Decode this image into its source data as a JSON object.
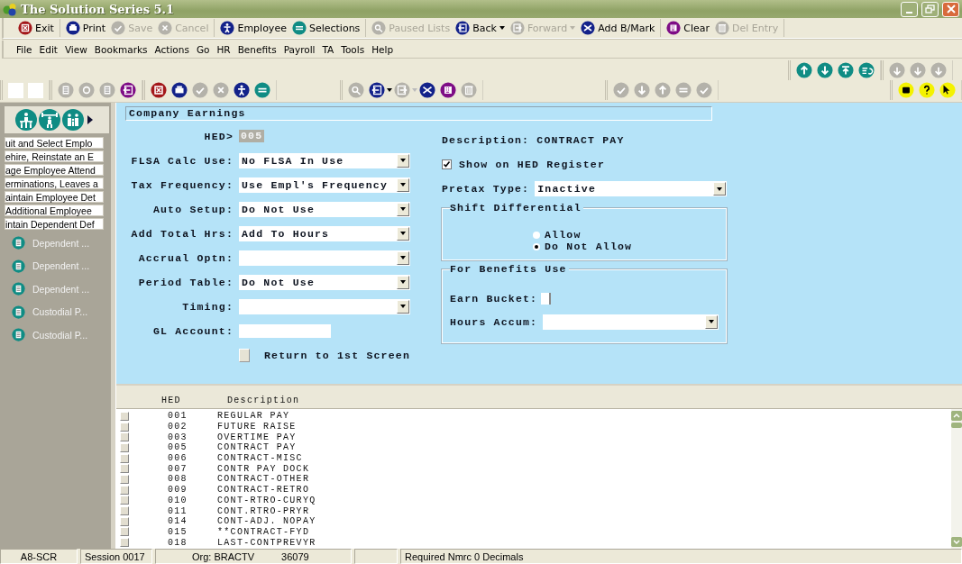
{
  "window": {
    "title": "The Solution Series  5.1"
  },
  "toolbar": [
    {
      "label": "Exit",
      "disabled": false
    },
    {
      "label": "Print",
      "disabled": false
    },
    {
      "label": "Save",
      "disabled": true
    },
    {
      "label": "Cancel",
      "disabled": true
    },
    {
      "label": "Employee",
      "disabled": false
    },
    {
      "label": "Selections",
      "disabled": false
    },
    {
      "label": "Paused Lists",
      "disabled": true
    },
    {
      "label": "Back",
      "disabled": false,
      "dropdown": true
    },
    {
      "label": "Forward",
      "disabled": true,
      "dropdown": true
    },
    {
      "label": "Add B/Mark",
      "disabled": false
    },
    {
      "label": "Clear",
      "disabled": false
    },
    {
      "label": "Del Entry",
      "disabled": true
    }
  ],
  "menu": [
    "File",
    "Edit",
    "View",
    "Bookmarks",
    "Actions",
    "Go",
    "HR",
    "Benefits",
    "Payroll",
    "TA",
    "Tools",
    "Help"
  ],
  "nav_toolbar": [
    {
      "disabled": false
    },
    {
      "disabled": false
    },
    {
      "disabled": false
    },
    {
      "disabled": false
    },
    {
      "disabled": true
    },
    {
      "disabled": true
    },
    {
      "disabled": true
    }
  ],
  "icon_toolbar": [
    {
      "disabled": true
    },
    {
      "disabled": true
    },
    {
      "disabled": true
    },
    {
      "disabled": false
    },
    {
      "disabled": false
    },
    {
      "disabled": false
    },
    {
      "disabled": true
    },
    {
      "disabled": true
    },
    {
      "disabled": false
    },
    {
      "disabled": false
    },
    {
      "disabled": true
    },
    {
      "disabled": false
    },
    {
      "disabled": true
    },
    {
      "disabled": false
    },
    {
      "disabled": false
    },
    {
      "disabled": true
    },
    {
      "disabled": true
    },
    {
      "disabled": true
    },
    {
      "disabled": true
    },
    {
      "disabled": true
    },
    {
      "disabled": true
    },
    {
      "disabled": false
    },
    {
      "disabled": false
    },
    {
      "disabled": false
    }
  ],
  "sidebar": {
    "links": [
      "uit and Select Emplo",
      "ehire, Reinstate an E",
      "age Employee Attend",
      "erminations, Leaves a",
      "aintain Employee Det",
      "Additional Employee",
      "intain Dependent Def"
    ],
    "items": [
      "Dependent ...",
      "Dependent ...",
      "Dependent ...",
      "Custodial P...",
      "Custodial P..."
    ]
  },
  "form": {
    "title": "Company Earnings",
    "hed": {
      "label": "HED>",
      "value": "005"
    },
    "fields": [
      {
        "label": "FLSA Calc Use:",
        "value": "No FLSA In Use",
        "kind": "dropdown"
      },
      {
        "label": "Tax Frequency:",
        "value": "Use Empl's Frequency",
        "kind": "dropdown"
      },
      {
        "label": "Auto Setup:",
        "value": "Do Not Use",
        "kind": "dropdown"
      },
      {
        "label": "Add Total Hrs:",
        "value": "Add To Hours",
        "kind": "dropdown"
      },
      {
        "label": "Accrual Optn:",
        "kind": "dropdown"
      },
      {
        "label": "Period Table:",
        "value": "Do Not Use",
        "kind": "dropdown"
      },
      {
        "label": "Timing:",
        "kind": "dropdown"
      },
      {
        "label": "GL Account:",
        "kind": "text"
      }
    ],
    "return_button": "Return to 1st Screen",
    "description": "Description: CONTRACT PAY",
    "show_on_register": {
      "label": "Show on HED Register",
      "checked": true
    },
    "pretax": {
      "label": "Pretax Type:",
      "value": "Inactive"
    },
    "shift_differential": {
      "title": "Shift Differential",
      "options": [
        {
          "label": "Allow",
          "selected": false
        },
        {
          "label": "Do Not Allow",
          "selected": true
        }
      ]
    },
    "benefits": {
      "title": "For Benefits Use",
      "earn_bucket": "Earn Bucket:",
      "hours_accum": "Hours Accum:"
    }
  },
  "list": {
    "columns": [
      "HED",
      "Description"
    ],
    "rows": [
      [
        "001",
        "REGULAR PAY"
      ],
      [
        "002",
        "FUTURE RAISE"
      ],
      [
        "003",
        "OVERTIME PAY"
      ],
      [
        "005",
        "CONTRACT PAY"
      ],
      [
        "006",
        "CONTRACT-MISC"
      ],
      [
        "007",
        "CONTR PAY DOCK"
      ],
      [
        "008",
        "CONTRACT-OTHER"
      ],
      [
        "009",
        "CONTRACT-RETRO"
      ],
      [
        "010",
        "CONT-RTRO-CURYQ"
      ],
      [
        "011",
        "CONT.RTRO-PRYR"
      ],
      [
        "014",
        "CONT-ADJ. NOPAY"
      ],
      [
        "015",
        "**CONTRACT-FYD"
      ],
      [
        "018",
        "LAST-CONTPREVYR"
      ]
    ]
  },
  "status_bar": [
    "A8-SCR",
    "Session 0017",
    "Org: BRACTV",
    "36079",
    "Required Nmrc 0 Decimals"
  ]
}
